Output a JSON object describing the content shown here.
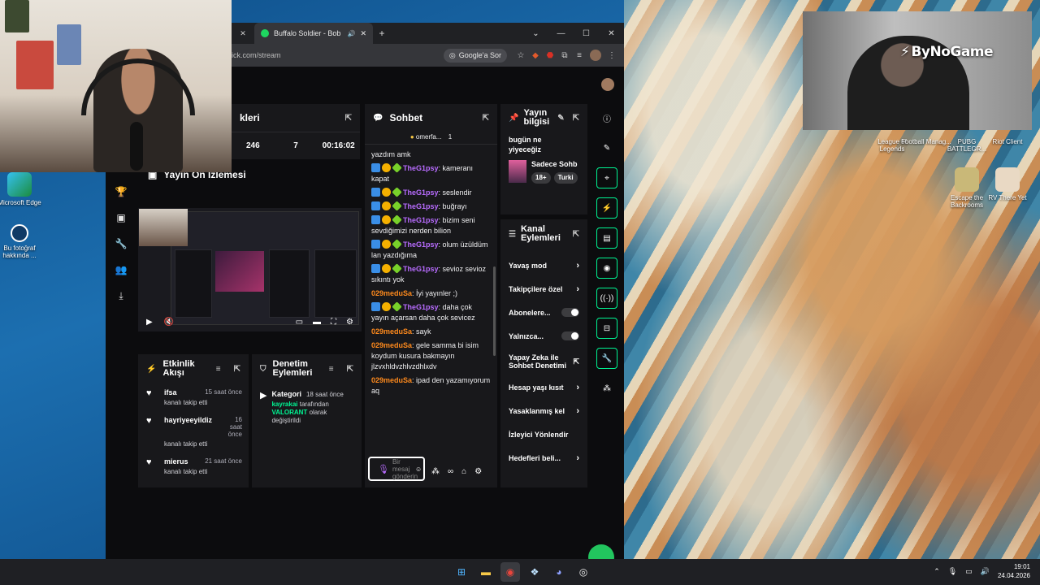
{
  "browser": {
    "tab_title": "Buffalo Soldier - Bob Marle",
    "url": "ick.com/stream",
    "google_button": "Google'a Sor"
  },
  "overlay": {
    "brand": "ByNoGame"
  },
  "desktop": {
    "left_icons": [
      {
        "label": "Microsoft Edge"
      },
      {
        "label": "Bu fotoğraf hakkında ..."
      }
    ],
    "right_icons": [
      {
        "label": "League of Legends"
      },
      {
        "label": "Football Manag..."
      },
      {
        "label": "PUBG BATTLEGR..."
      },
      {
        "label": "Riot Client"
      },
      {
        "label": "Escape the Backrooms"
      },
      {
        "label": "RV There Yet"
      }
    ]
  },
  "stats": {
    "title": "kleri",
    "values": [
      "246",
      "7",
      "00:16:02"
    ]
  },
  "preview": {
    "title": "Yayın Ön İzlemesi"
  },
  "activity": {
    "title": "Etkinlik Akışı",
    "items": [
      {
        "name": "ifsa",
        "time": "15 saat önce",
        "action": "kanalı takip etti"
      },
      {
        "name": "hayriyeeyildiz",
        "time": "16 saat önce",
        "action": "kanalı takip etti"
      },
      {
        "name": "mierus",
        "time": "21 saat önce",
        "action": "kanalı takip etti"
      }
    ]
  },
  "moderation": {
    "title": "Denetim Eylemleri",
    "item": {
      "label": "Kategori",
      "time": "18 saat önce",
      "user": "kayrakai",
      "text1": "tarafından",
      "game": "VALORANT",
      "text2": "olarak değiştirildi"
    }
  },
  "chat": {
    "title": "Sohbet",
    "sub_user": "omerfa...",
    "sub_count": "1",
    "messages": [
      {
        "user": "",
        "text": "yazdım amk",
        "color": "plain"
      },
      {
        "user": "TheG1psy",
        "text": ": kameranı kapat",
        "color": "purple"
      },
      {
        "user": "TheG1psy",
        "text": ": seslendir",
        "color": "purple"
      },
      {
        "user": "TheG1psy",
        "text": ": buğrayı",
        "color": "purple"
      },
      {
        "user": "TheG1psy",
        "text": ": bizim seni sevdiğimizi nerden bilion",
        "color": "purple"
      },
      {
        "user": "TheG1psy",
        "text": ": olum üzüldüm lan yazdığıma",
        "color": "purple"
      },
      {
        "user": "TheG1psy",
        "text": ": sevioz sevioz sıkıntı yok",
        "color": "purple"
      },
      {
        "user": "029meduSa",
        "text": ": İyi yayınler ;)",
        "color": "orange"
      },
      {
        "user": "TheG1psy",
        "text": ": daha çok yayın açarsan daha çok sevicez",
        "color": "purple"
      },
      {
        "user": "029meduSa",
        "text": ": sayk",
        "color": "orange"
      },
      {
        "user": "029meduSa",
        "text": ": gele samma bi isim koydum kusura bakmayın jlzvxhldvzhlvzdhlxdv",
        "color": "orange"
      },
      {
        "user": "029meduSa",
        "text": ": ipad den yazamıyorum aq",
        "color": "orange"
      }
    ],
    "input_placeholder": "Bir mesaj gönderin"
  },
  "stream_info": {
    "title": "Yayın bilgisi",
    "stream_title": "bugün ne yiyeceğiz",
    "category": "Sadece Sohb",
    "tags": [
      "18+",
      "Turki"
    ]
  },
  "channel_actions": {
    "title": "Kanal Eylemleri",
    "items": [
      {
        "label": "Yavaş mod",
        "control": "chevron"
      },
      {
        "label": "Takipçilere özel",
        "control": "chevron"
      },
      {
        "label": "Abonelere...",
        "control": "toggle"
      },
      {
        "label": "Yalnızca...",
        "control": "toggle"
      },
      {
        "label": "Yapay Zeka ile Sohbet Denetimi",
        "control": "external"
      },
      {
        "label": "Hesap yaşı kısıt",
        "control": "chevron"
      },
      {
        "label": "Yasaklanmış kel",
        "control": "chevron"
      },
      {
        "label": "İzleyici Yönlendir",
        "control": "none"
      },
      {
        "label": "Hedefleri beli...",
        "control": "chevron"
      }
    ]
  },
  "taskbar": {
    "time": "19:01",
    "date": "24.04.2026"
  }
}
